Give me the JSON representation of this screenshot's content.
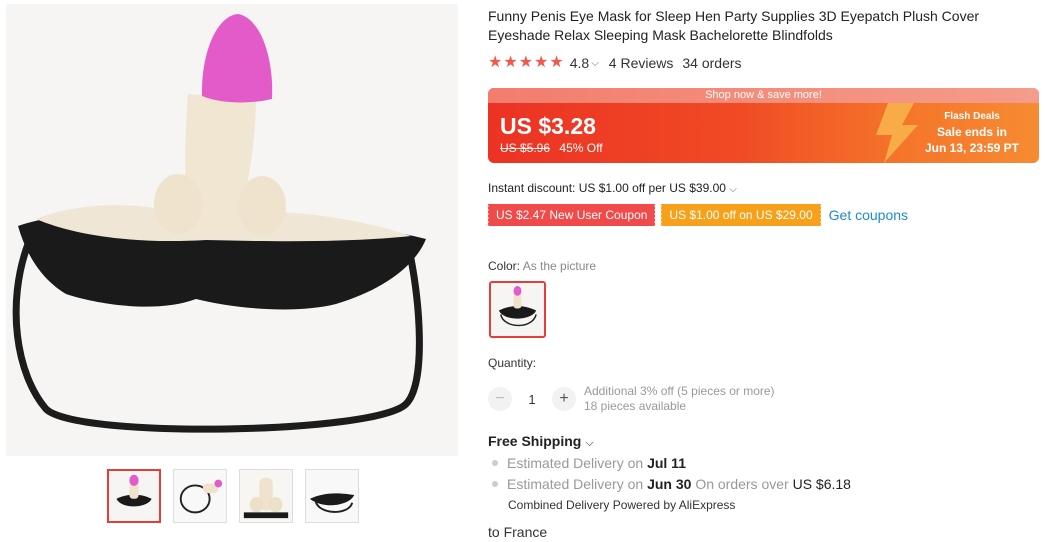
{
  "product": {
    "title": "Funny Penis Eye Mask for Sleep Hen Party Supplies 3D Eyepatch Plush Cover Eyeshade Relax Sleeping Mask Bachelorette Blindfolds",
    "rating": "4.8",
    "reviews": "4 Reviews",
    "orders": "34 orders"
  },
  "banner": {
    "top_text": "Shop now & save more!",
    "price": "US $3.28",
    "original_price": "US $5.96",
    "discount": "45% Off",
    "flash_title": "Flash Deals",
    "flash_sale": "Sale ends in",
    "flash_date": "Jun 13, 23:59 PT"
  },
  "instant_discount": "Instant discount: US $1.00 off per US $39.00",
  "coupons": {
    "new_user": "US $2.47 New User Coupon",
    "off": "US $1.00 off on US $29.00",
    "get": "Get coupons"
  },
  "color": {
    "label": "Color:",
    "value": "As the picture"
  },
  "quantity": {
    "label": "Quantity:",
    "value": "1",
    "minus": "−",
    "plus": "+",
    "note1": "Additional 3% off (5 pieces or more)",
    "note2": "18 pieces available"
  },
  "shipping": {
    "title": "Free Shipping",
    "d1_prefix": "Estimated Delivery on",
    "d1_date": "Jul 11",
    "d2_prefix": "Estimated Delivery on",
    "d2_date": "Jun 30",
    "d2_mid": "On orders over",
    "d2_amount": "US $6.18",
    "combined": "Combined Delivery Powered by AliExpress",
    "to_prefix": "to",
    "to_country": "France"
  },
  "icons": [
    "star-icon",
    "chevron-down-icon",
    "lightning-bolt-icon"
  ],
  "colors": {
    "accent": "#f15a4b",
    "link": "#1b8ad6",
    "coupon_red": "#f04a4a",
    "coupon_orange": "#f7a11a"
  }
}
